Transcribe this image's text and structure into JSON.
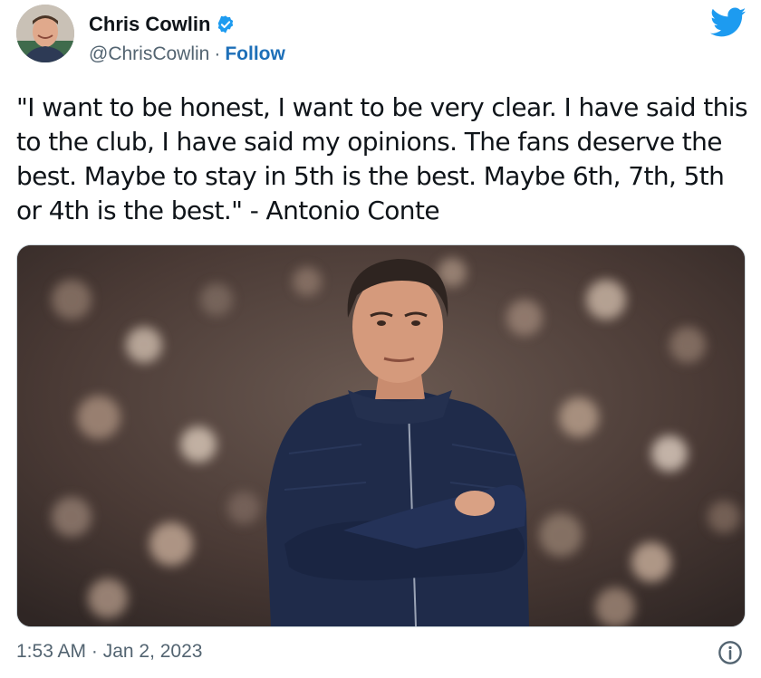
{
  "author": {
    "name": "Chris Cowlin",
    "handle": "@ChrisCowlin",
    "separator": "·",
    "follow_label": "Follow",
    "verified": true,
    "avatar_icon": "profile-photo"
  },
  "tweet": {
    "text": "\"I want to be honest, I want to be very clear. I have said this to the club, I have said my opinions. The fans deserve the best. Maybe to stay in 5th is the best. Maybe 6th, 7th, 5th or 4th is the best.\" - Antonio Conte",
    "timestamp": "1:53 AM · Jan 2, 2023"
  },
  "media": {
    "icon": "photo-man-arms-crossed-stadium"
  },
  "icons": {
    "brand": "twitter-bird-icon",
    "info": "info-icon",
    "verified": "verified-badge-icon"
  },
  "colors": {
    "brand": "#1d9bf0",
    "follow": "#1d6fb8",
    "secondary_text": "#536471",
    "primary_text": "#0f1419"
  }
}
